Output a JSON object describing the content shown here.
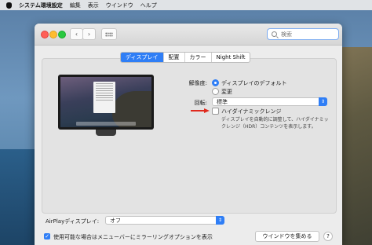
{
  "menubar": {
    "app_name": "システム環境設定",
    "items": [
      "編集",
      "表示",
      "ウインドウ",
      "ヘルプ"
    ]
  },
  "toolbar": {
    "back_symbol": "‹",
    "forward_symbol": "›",
    "search_placeholder": "検索"
  },
  "tabs": [
    {
      "label": "ディスプレイ",
      "active": true
    },
    {
      "label": "配置",
      "active": false
    },
    {
      "label": "カラー",
      "active": false
    },
    {
      "label": "Night Shift",
      "active": false
    }
  ],
  "display": {
    "resolution_label": "解像度:",
    "resolution_options": [
      {
        "label": "ディスプレイのデフォルト",
        "selected": true
      },
      {
        "label": "変更",
        "selected": false
      }
    ],
    "rotation_label": "回転:",
    "rotation_value": "標準",
    "hdr_label": "ハイダイナミックレンジ",
    "hdr_checked": false,
    "hdr_description": "ディスプレイを自動的に調整して、ハイダイナミックレンジ（HDR）コンテンツを表示します。"
  },
  "footer": {
    "airplay_label": "AirPlayディスプレイ:",
    "airplay_value": "オフ",
    "mirroring_label": "使用可能な場合はメニューバーにミラーリングオプションを表示",
    "mirroring_checked": true,
    "gather_windows_button": "ウインドウを集める",
    "help_button": "?"
  },
  "colors": {
    "accent": "#2f7ef6",
    "annotation_arrow": "#e02a1e"
  },
  "icons": [
    "apple-icon",
    "search-icon",
    "grid-icon",
    "chevron-up-down-icon",
    "checkmark-icon"
  ]
}
